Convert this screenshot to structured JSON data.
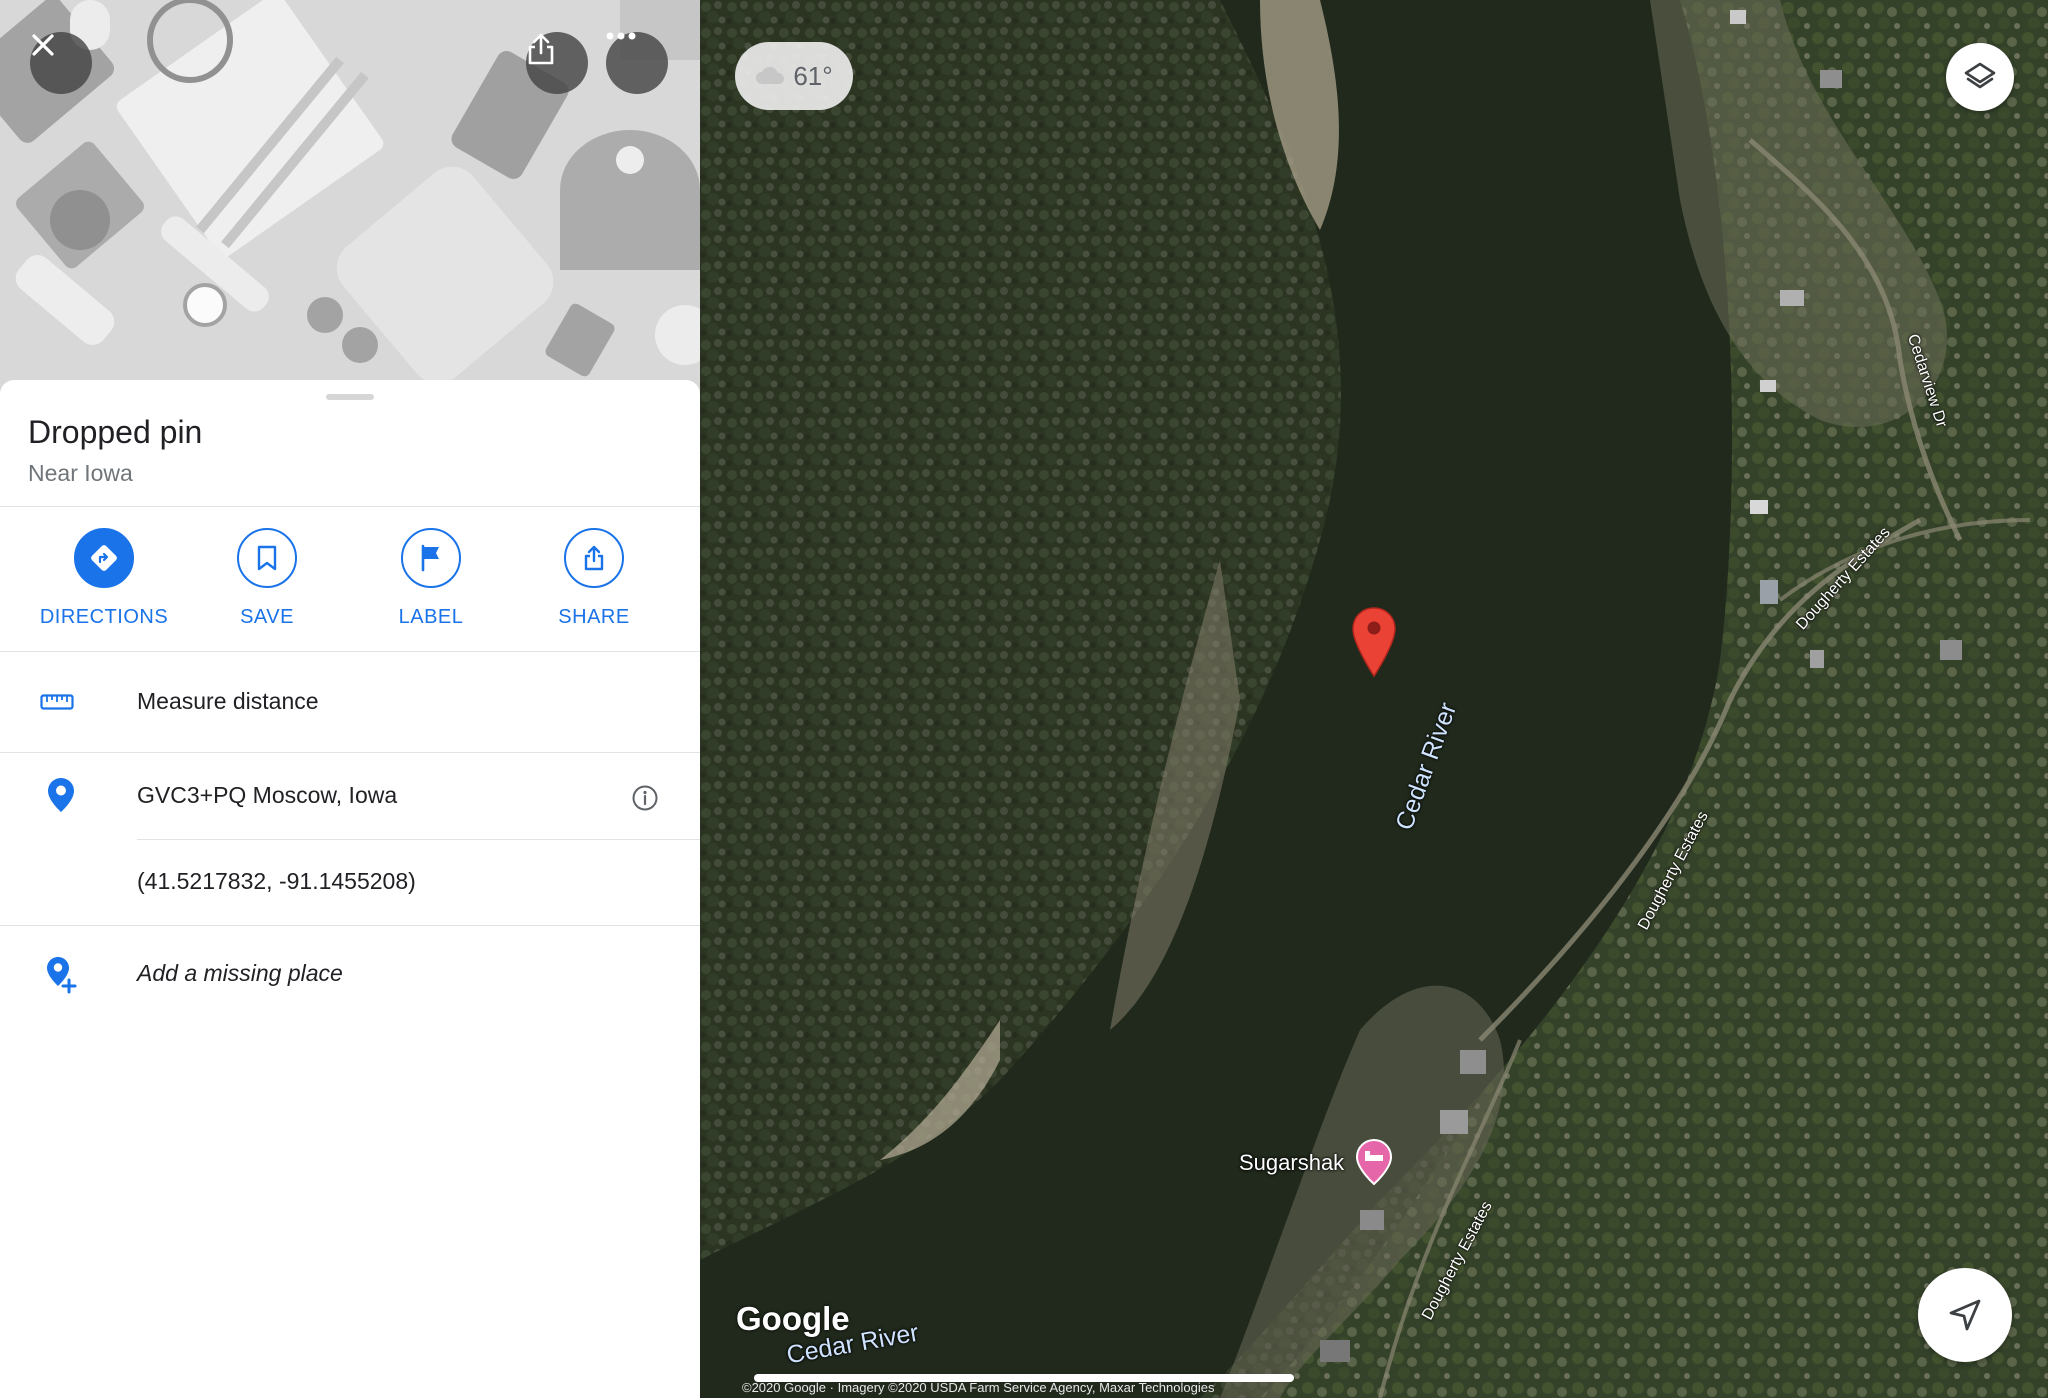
{
  "hero": {
    "close_icon": "close-icon",
    "share_icon": "share-icon",
    "more_icon": "more-icon"
  },
  "place": {
    "title": "Dropped pin",
    "subtitle": "Near Iowa"
  },
  "actions": [
    {
      "label": "DIRECTIONS",
      "icon": "directions-icon"
    },
    {
      "label": "SAVE",
      "icon": "bookmark-icon"
    },
    {
      "label": "LABEL",
      "icon": "flag-icon"
    },
    {
      "label": "SHARE",
      "icon": "share-icon"
    }
  ],
  "rows": {
    "measure": "Measure distance",
    "plus_code": "GVC3+PQ Moscow, Iowa",
    "coordinates": "(41.5217832, -91.1455208)",
    "add_place": "Add a missing place"
  },
  "map": {
    "temperature": "61°",
    "river_label": "Cedar River",
    "river_label_bottom": "Cedar River",
    "poi_label": "Sugarshak",
    "roads": [
      "Cedarview Dr",
      "Dougherty Estates",
      "Dougherty Estates",
      "Dougherty Estates"
    ],
    "logo": "Google",
    "copyright": "©2020 Google · Imagery ©2020 USDA Farm Service Agency, Maxar Technologies"
  },
  "colors": {
    "accent": "#1a73e8",
    "pin": "#ea4335",
    "poi": "#e667a9"
  }
}
